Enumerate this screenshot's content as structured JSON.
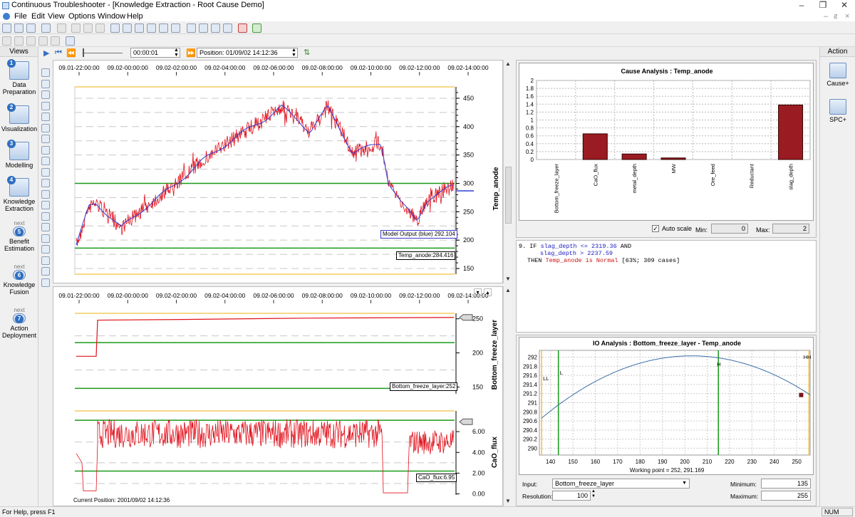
{
  "window": {
    "title": "Continuous Troubleshooter - [Knowledge Extraction - Root Cause Demo]"
  },
  "menu": [
    "File",
    "Edit",
    "View",
    "Options",
    "Window",
    "Help"
  ],
  "views": {
    "header": "Views",
    "items": [
      {
        "num": "1",
        "label": "Data Preparation",
        "prefix": ""
      },
      {
        "num": "2",
        "label": "Visualization",
        "prefix": ""
      },
      {
        "num": "3",
        "label": "Modelling",
        "prefix": ""
      },
      {
        "num": "4",
        "label": "Knowledge Extraction",
        "prefix": ""
      },
      {
        "num": "5",
        "label": "Benefit Estimation",
        "prefix": "next"
      },
      {
        "num": "6",
        "label": "Knowledge Fusion",
        "prefix": "next"
      },
      {
        "num": "7",
        "label": "Action Deployment",
        "prefix": "next"
      }
    ]
  },
  "action": {
    "header": "Action",
    "items": [
      "Cause+",
      "SPC+"
    ]
  },
  "nav": {
    "step": "00:00:01",
    "position": "Position: 01/09/02 14:12:36"
  },
  "time_axis": [
    "09.01-22:00:00",
    "09.02-00:00:00",
    "09.02-02:00:00",
    "09.02-04:00:00",
    "09.02-06:00:00",
    "09.02-08:00:00",
    "09.02-10:00:00",
    "09.02-12:00:00",
    "09.02-14:00:00"
  ],
  "top_chart": {
    "ylabel": "Temp_anode",
    "yticks": [
      "450",
      "400",
      "350",
      "300",
      "250",
      "200",
      "150"
    ],
    "model_label": "Model Output (blue) 292.104",
    "value_label": "Temp_anode:284.416"
  },
  "bottom_chart": {
    "ylabel1": "Bottom_freeze_layer",
    "yticks1": [
      "250",
      "200",
      "150"
    ],
    "value_label1": "Bottom_freeze_layer:252",
    "ylabel2": "CaO_flux",
    "yticks2": [
      "6.00",
      "4.00",
      "2.00",
      "0.00"
    ],
    "value_label2": "CaO_flux:6.95"
  },
  "current_position": "Current Position: 2001/09/02 14:12:36",
  "cause": {
    "title": "Cause Analysis : Temp_anode",
    "autoscale": "Auto scale",
    "min_label": "Min:",
    "min": "0",
    "max_label": "Max:",
    "max": "2"
  },
  "chart_data": {
    "type": "bar",
    "title": "Cause Analysis : Temp_anode",
    "categories": [
      "Bottom_freeze_layer",
      "CaO_flux",
      "metal_depth",
      "MW",
      "Ore_feed",
      "Reductant",
      "slag_depth"
    ],
    "values": [
      0,
      0.65,
      0.14,
      0.04,
      0,
      0,
      1.38
    ],
    "ylim": [
      0,
      2
    ],
    "yticks": [
      "2",
      "1.8",
      "1.6",
      "1.4",
      "1.2",
      "1",
      "0.8",
      "0.6",
      "0.4",
      "0.2",
      "0"
    ],
    "color": "#9b1b22"
  },
  "rule": {
    "l1a": "9. IF ",
    "l1b": "slag_depth <= 2319.36",
    "l1c": " AND",
    "l2": "slag_depth  > 2237.59",
    "l3a": "THEN ",
    "l3b": "Temp_anode is Normal",
    "l3c": " [63%; 309 cases]"
  },
  "io": {
    "title": "IO Analysis : Bottom_freeze_layer - Temp_anode",
    "yticks": [
      "292",
      "291.8",
      "291.6",
      "291.4",
      "291.2",
      "291",
      "290.8",
      "290.6",
      "290.4",
      "290.2",
      "290"
    ],
    "xticks": [
      "140",
      "150",
      "160",
      "170",
      "180",
      "190",
      "200",
      "210",
      "220",
      "230",
      "240",
      "250"
    ],
    "markers": [
      "LL",
      "L",
      "H",
      "HH"
    ],
    "working_point": "Working point = 252, 291.169",
    "input_label": "Input:",
    "input_value": "Bottom_freeze_layer",
    "resolution_label": "Resolution:",
    "resolution": "100",
    "minimum_label": "Minimum:",
    "minimum": "135",
    "maximum_label": "Maximum:",
    "maximum": "255"
  },
  "status": {
    "help": "For Help, press F1",
    "num": "NUM"
  },
  "colors": {
    "series_red": "#e0111c",
    "model_blue": "#2f3fd0",
    "limit_green": "#1a9a1a",
    "limit_orange": "#f0c040"
  }
}
